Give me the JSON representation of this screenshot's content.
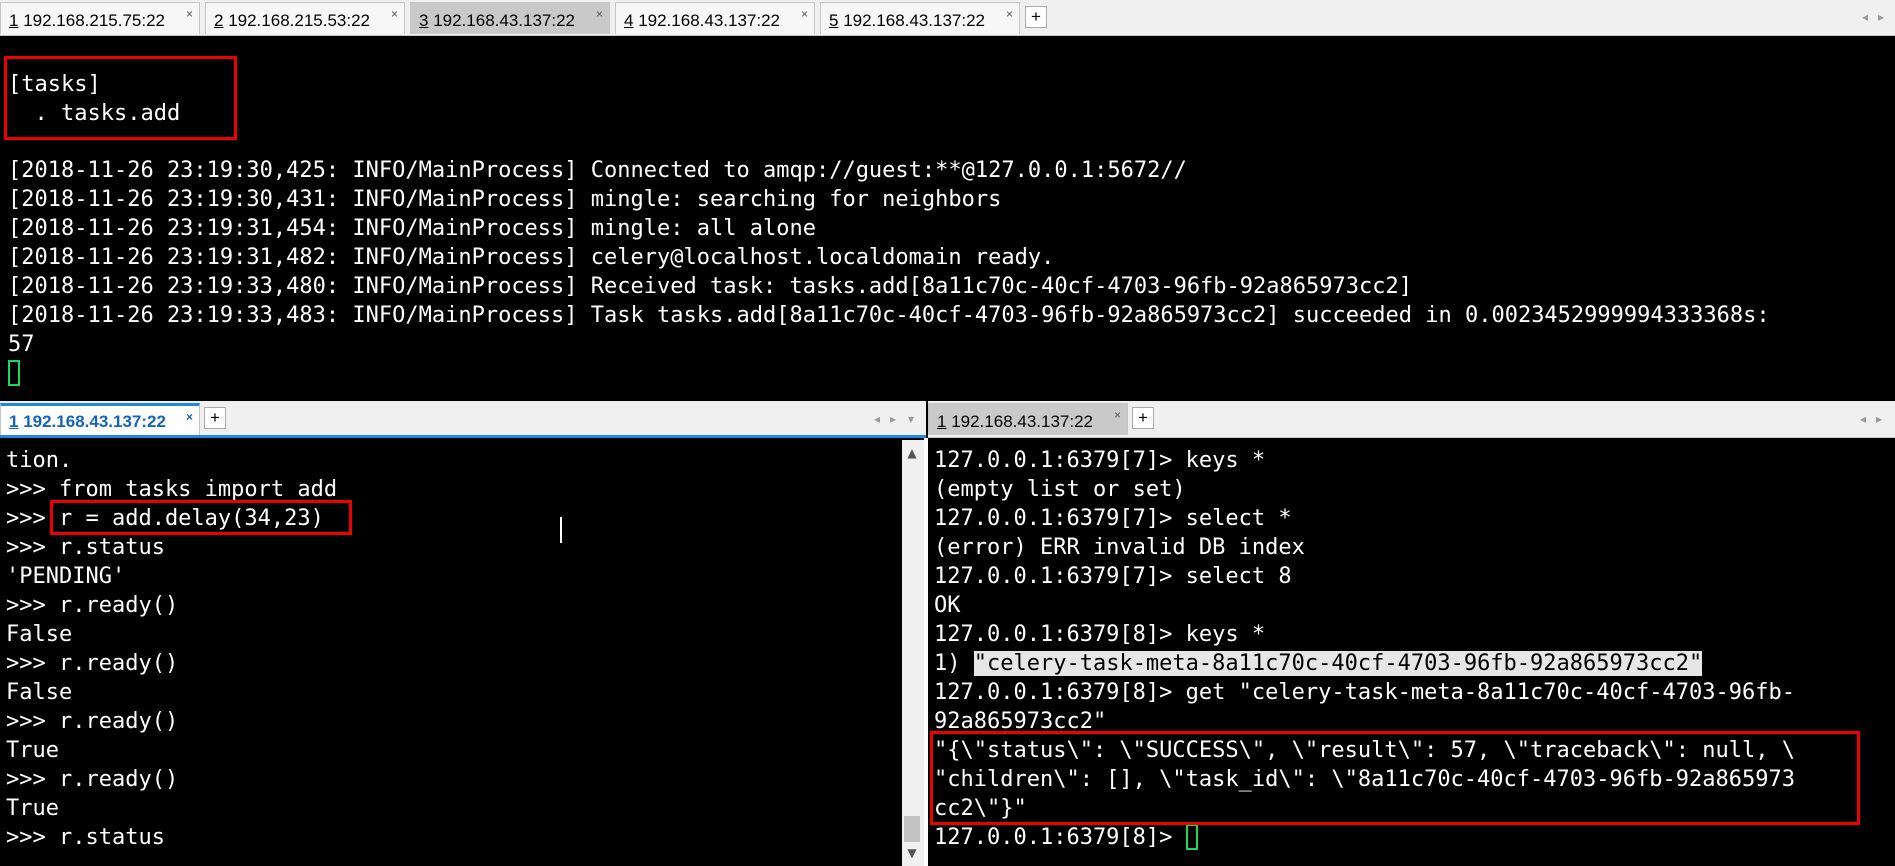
{
  "top_tabs": [
    {
      "num": "1",
      "host": " 192.168.215.75:22"
    },
    {
      "num": "2",
      "host": " 192.168.215.53:22"
    },
    {
      "num": "3",
      "host": " 192.168.43.137:22"
    },
    {
      "num": "4",
      "host": " 192.168.43.137:22"
    },
    {
      "num": "5",
      "host": " 192.168.43.137:22"
    }
  ],
  "add_tab": "+",
  "close_glyph": "×",
  "top_terminal": {
    "header_lines": [
      "[tasks]",
      "  . tasks.add"
    ],
    "log_lines": [
      "[2018-11-26 23:19:30,425: INFO/MainProcess] Connected to amqp://guest:**@127.0.0.1:5672//",
      "[2018-11-26 23:19:30,431: INFO/MainProcess] mingle: searching for neighbors",
      "[2018-11-26 23:19:31,454: INFO/MainProcess] mingle: all alone",
      "[2018-11-26 23:19:31,482: INFO/MainProcess] celery@localhost.localdomain ready.",
      "[2018-11-26 23:19:33,480: INFO/MainProcess] Received task: tasks.add[8a11c70c-40cf-4703-96fb-92a865973cc2]",
      "[2018-11-26 23:19:33,483: INFO/MainProcess] Task tasks.add[8a11c70c-40cf-4703-96fb-92a865973cc2] succeeded in 0.0023452999994333368s:",
      "57"
    ]
  },
  "left_pane": {
    "tab": {
      "num": "1",
      "host": " 192.168.43.137:22"
    },
    "lines": [
      "tion.",
      ">>> from tasks import add",
      ">>> r = add.delay(34,23)",
      ">>> r.status",
      "'PENDING'",
      ">>> r.ready()",
      "False",
      ">>> r.ready()",
      "False",
      ">>> r.ready()",
      "True",
      ">>> r.ready()",
      "True",
      ">>> r.status"
    ]
  },
  "right_pane": {
    "tab": {
      "num": "1",
      "host": " 192.168.43.137:22"
    },
    "lines_before": [
      "127.0.0.1:6379[7]> keys *",
      "(empty list or set)",
      "127.0.0.1:6379[7]> select *",
      "(error) ERR invalid DB index",
      "127.0.0.1:6379[7]> select 8",
      "OK",
      "127.0.0.1:6379[8]> keys *"
    ],
    "keys_prefix": "1) ",
    "keys_result": "\"celery-task-meta-8a11c70c-40cf-4703-96fb-92a865973cc2\"",
    "lines_after": [
      "127.0.0.1:6379[8]> get \"celery-task-meta-8a11c70c-40cf-4703-96fb-",
      "92a865973cc2\"",
      "\"{\\\"status\\\": \\\"SUCCESS\\\", \\\"result\\\": 57, \\\"traceback\\\": null, \\",
      "\"children\\\": [], \\\"task_id\\\": \\\"8a11c70c-40cf-4703-96fb-92a865973",
      "cc2\\\"}\""
    ],
    "prompt": "127.0.0.1:6379[8]> "
  }
}
